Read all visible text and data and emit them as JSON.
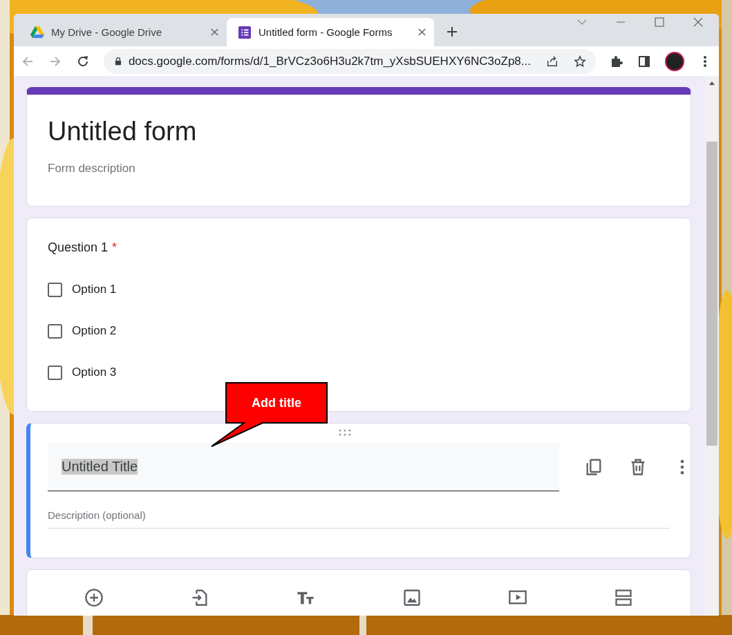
{
  "tabs": [
    {
      "label": "My Drive - Google Drive",
      "selected": false,
      "kind": "drive"
    },
    {
      "label": "Untitled form - Google Forms",
      "selected": true,
      "kind": "forms"
    }
  ],
  "address_bar": {
    "url": "docs.google.com/forms/d/1_BrVCz3o6H3u2k7tm_yXsbSUEHXY6NC3oZp8..."
  },
  "form_header": {
    "title": "Untitled form",
    "placeholder": "Form description"
  },
  "question": {
    "title": "Question 1",
    "required_mark": "*",
    "options": [
      {
        "label": "Option 1",
        "checked": false
      },
      {
        "label": "Option 2",
        "checked": false
      },
      {
        "label": "Option 3",
        "checked": false
      }
    ]
  },
  "title_item": {
    "value": "Untitled Title",
    "text_selected": true,
    "placeholder": "Description (optional)"
  },
  "callout": {
    "text": "Add title"
  }
}
